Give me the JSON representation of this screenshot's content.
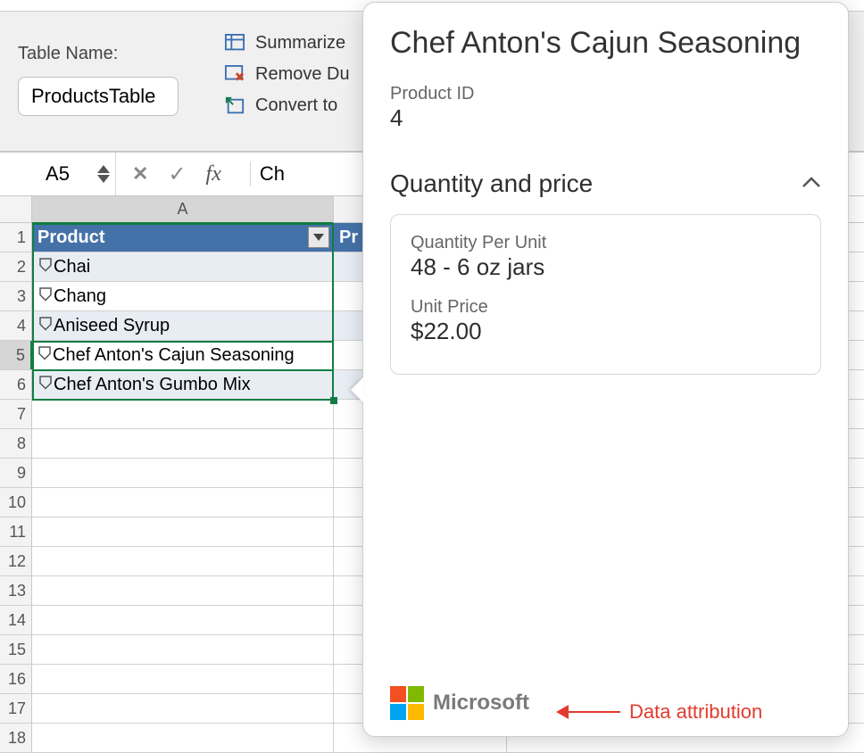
{
  "ribbon": {
    "table_name_label": "Table Name:",
    "table_name_value": "ProductsTable",
    "tools": {
      "summarize": "Summarize",
      "remove_dup": "Remove Du",
      "convert": "Convert to"
    }
  },
  "formula_bar": {
    "cell_ref": "A5",
    "formula_text": "Ch"
  },
  "grid": {
    "column_letter_a": "A",
    "header_product": "Product",
    "header_next_prefix": "Pr",
    "rows": [
      "Chai",
      "Chang",
      "Aniseed Syrup",
      "Chef Anton's Cajun Seasoning",
      "Chef Anton's Gumbo Mix"
    ],
    "selected_row_index": 3
  },
  "card": {
    "title": "Chef Anton's Cajun Seasoning",
    "fields": {
      "product_id_label": "Product ID",
      "product_id_value": "4"
    },
    "section_title": "Quantity and price",
    "box": {
      "qpu_label": "Quantity Per Unit",
      "qpu_value": "48 - 6 oz jars",
      "price_label": "Unit Price",
      "price_value": "$22.00"
    },
    "attribution_brand": "Microsoft"
  },
  "annotation": {
    "text": "Data attribution"
  }
}
